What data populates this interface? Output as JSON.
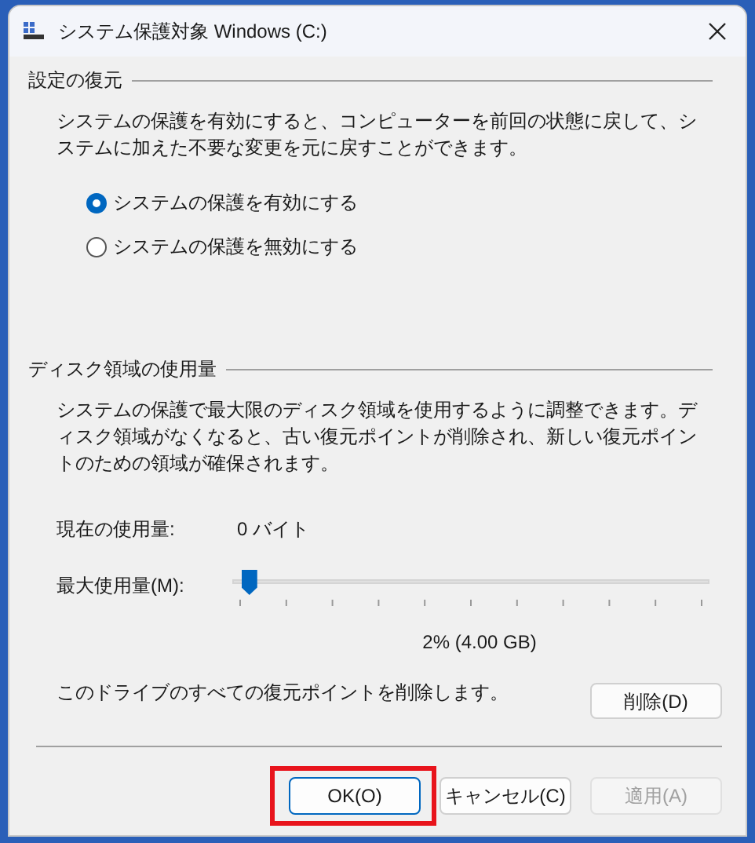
{
  "window": {
    "title": "システム保護対象 Windows (C:)"
  },
  "restore_settings": {
    "heading": "設定の復元",
    "description": "システムの保護を有効にすると、コンピューターを前回の状態に戻して、システムに加えた不要な変更を元に戻すことができます。",
    "options": [
      {
        "label": "システムの保護を有効にする",
        "selected": true
      },
      {
        "label": "システムの保護を無効にする",
        "selected": false
      }
    ]
  },
  "disk_usage": {
    "heading": "ディスク領域の使用量",
    "description": "システムの保護で最大限のディスク領域を使用するように調整できます。ディスク領域がなくなると、古い復元ポイントが削除され、新しい復元ポイントのための領域が確保されます。",
    "current_label": "現在の使用量:",
    "current_value": "0 バイト",
    "max_label": "最大使用量(M):",
    "max_slider": {
      "level": 0.02
    },
    "max_reading": "2% (4.00 GB)",
    "delete_text": "このドライブのすべての復元ポイントを削除します。",
    "delete_button": "削除(D)"
  },
  "buttons": [
    {
      "label": "OK(O)",
      "disabled": false,
      "highlighted": true
    },
    {
      "label": "キャンセル(C)",
      "disabled": false,
      "highlighted": false
    },
    {
      "label": "適用(A)",
      "disabled": true,
      "highlighted": false
    }
  ]
}
